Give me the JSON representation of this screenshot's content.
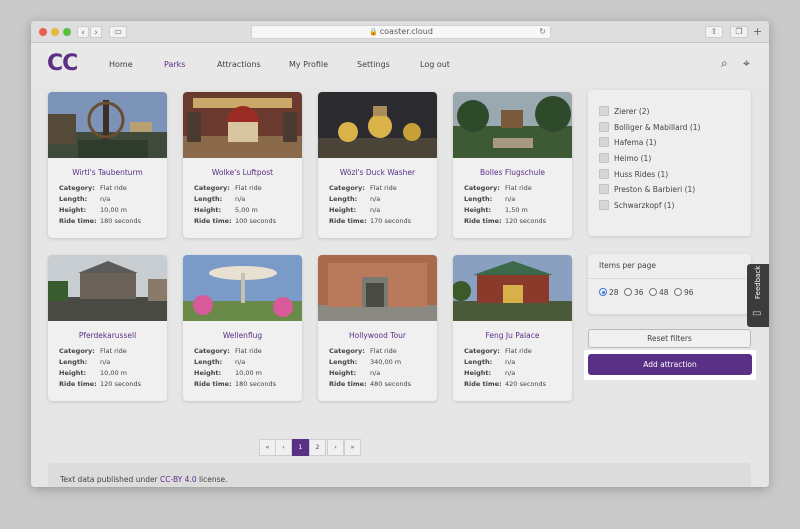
{
  "browser": {
    "address": "coaster.cloud"
  },
  "header": {
    "logo": "CC",
    "menu": [
      "Home",
      "Parks",
      "Attractions",
      "My Profile",
      "Settings",
      "Log out"
    ],
    "active": "Parks"
  },
  "spec_labels": {
    "category": "Category:",
    "length": "Length:",
    "height": "Height:",
    "ride_time": "Ride time:"
  },
  "cards": [
    {
      "title": "Wirtl's Taubenturm",
      "category": "Flat ride",
      "length": "n/a",
      "height": "10,00 m",
      "ride_time": "180 seconds"
    },
    {
      "title": "Wolke's Luftpost",
      "category": "Flat ride",
      "length": "n/a",
      "height": "5,00 m",
      "ride_time": "100 seconds"
    },
    {
      "title": "Wözl's Duck Washer",
      "category": "Flat ride",
      "length": "n/a",
      "height": "n/a",
      "ride_time": "170 seconds"
    },
    {
      "title": "Bolles Flugschule",
      "category": "Flat ride",
      "length": "n/a",
      "height": "1,50 m",
      "ride_time": "120 seconds"
    },
    {
      "title": "Pferdekarussell",
      "category": "Flat ride",
      "length": "n/a",
      "height": "10,00 m",
      "ride_time": "120 seconds"
    },
    {
      "title": "Wellenflug",
      "category": "Flat ride",
      "length": "n/a",
      "height": "10,00 m",
      "ride_time": "180 seconds"
    },
    {
      "title": "Hollywood Tour",
      "category": "Flat ride",
      "length": "340,00 m",
      "height": "n/a",
      "ride_time": "480 seconds"
    },
    {
      "title": "Feng Ju Palace",
      "category": "Flat ride",
      "length": "n/a",
      "height": "n/a",
      "ride_time": "420 seconds"
    }
  ],
  "pagination": [
    "«",
    "‹",
    "1",
    "2",
    "›",
    "»"
  ],
  "manufacturers": [
    "Zierer (2)",
    "Bolliger & Mabillard (1)",
    "Hafema (1)",
    "Heimo (1)",
    "Huss Rides (1)",
    "Preston & Barbieri (1)",
    "Schwarzkopf (1)"
  ],
  "items_per_page": {
    "title": "Items per page",
    "options": [
      "28",
      "36",
      "48",
      "96"
    ],
    "selected": "28"
  },
  "buttons": {
    "reset": "Reset filters",
    "add": "Add attraction"
  },
  "footer": {
    "prefix": "Text data published under ",
    "license": "CC-BY 4.0",
    "suffix": " license."
  },
  "feedback": "Feedback",
  "colors": {
    "brand": "#5a2f86",
    "radio": "#3a78d6"
  }
}
